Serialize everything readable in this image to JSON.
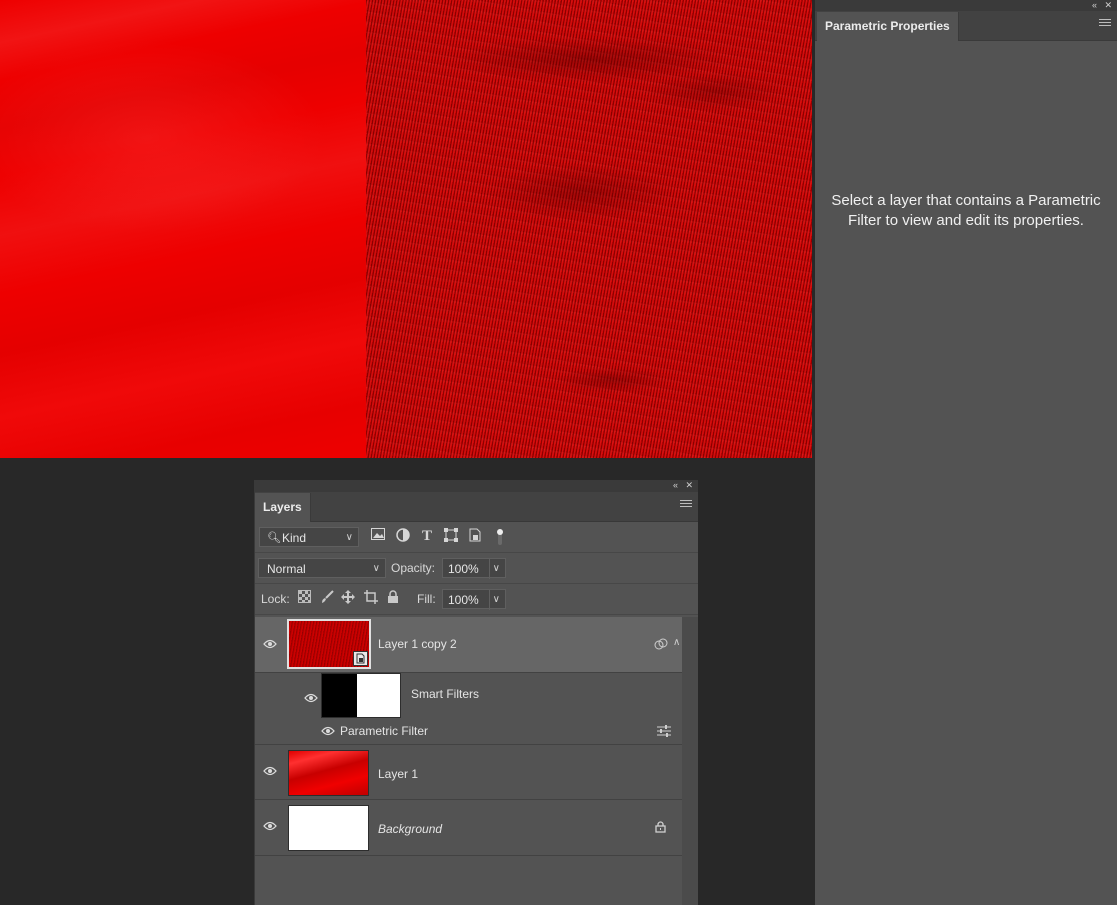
{
  "props_panel": {
    "tab_label": "Parametric Properties",
    "message": "Select a layer that contains a Parametric Filter to view and edit its properties."
  },
  "layers_panel": {
    "tab_label": "Layers",
    "filter": {
      "kind_label": "Kind"
    },
    "blend": {
      "mode": "Normal",
      "opacity_label": "Opacity:",
      "opacity_value": "100%"
    },
    "lock": {
      "lock_label": "Lock:",
      "fill_label": "Fill:",
      "fill_value": "100%"
    },
    "layers": [
      {
        "name": "Layer 1 copy 2",
        "selected": true,
        "smart_object": true
      },
      {
        "name": "Smart Filters",
        "type": "smart-filters-mask"
      },
      {
        "name": "Parametric Filter",
        "type": "filter"
      },
      {
        "name": "Layer 1"
      },
      {
        "name": "Background",
        "locked": true
      }
    ]
  },
  "colors": {
    "canvas_red": "#ee0000",
    "panel_bg": "#535353",
    "selected_layer_bg": "#666666",
    "app_bg": "#282828"
  },
  "icons": {
    "collapse": "double-chevron-left-icon",
    "close": "close-icon",
    "menu": "hamburger-menu-icon",
    "eye": "eye-icon",
    "lock": "padlock-icon",
    "filter_options": "sliders-icon"
  }
}
